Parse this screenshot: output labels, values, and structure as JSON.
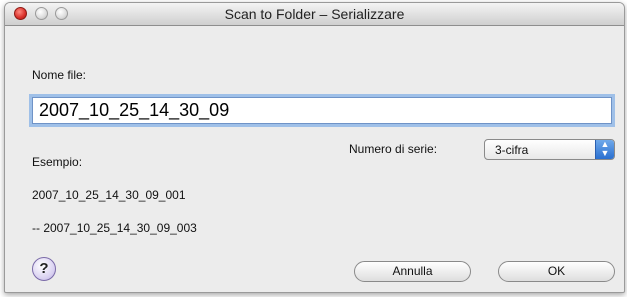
{
  "window": {
    "title": "Scan to Folder – Serializzare"
  },
  "form": {
    "filename_label": "Nome file:",
    "filename_value": "2007_10_25_14_30_09",
    "serial_label": "Numero di serie:",
    "serial_value": "3-cifra",
    "example_label": "Esempio:",
    "example_first": "2007_10_25_14_30_09_001",
    "example_last": "-- 2007_10_25_14_30_09_003"
  },
  "buttons": {
    "help": "?",
    "cancel": "Annulla",
    "ok": "OK"
  }
}
